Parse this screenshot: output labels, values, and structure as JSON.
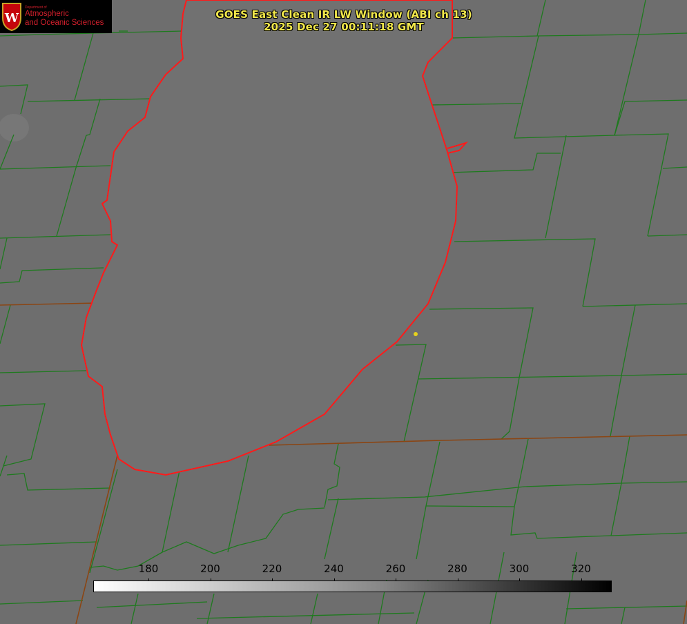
{
  "title": {
    "line1": "GOES East Clean IR LW Window (ABI ch 13)",
    "line2": "2025 Dec 27 00:11:18 GMT"
  },
  "logo": {
    "department_line": "Department of",
    "line1": "Atmospheric",
    "line2": "and Oceanic Sciences",
    "seal_letter": "W",
    "seal_color": "#c5050c"
  },
  "colorbar": {
    "ticks": [
      "180",
      "200",
      "220",
      "240",
      "260",
      "280",
      "300",
      "320"
    ],
    "min_color": "#ffffff",
    "max_color": "#000000"
  },
  "colors": {
    "background": "#6e6e6e",
    "lake": "#717171",
    "boundaries": "#1e7a1e",
    "state_lines": "#8b4513",
    "coastline": "#ff1a1a",
    "marker": "#e6d21e"
  }
}
